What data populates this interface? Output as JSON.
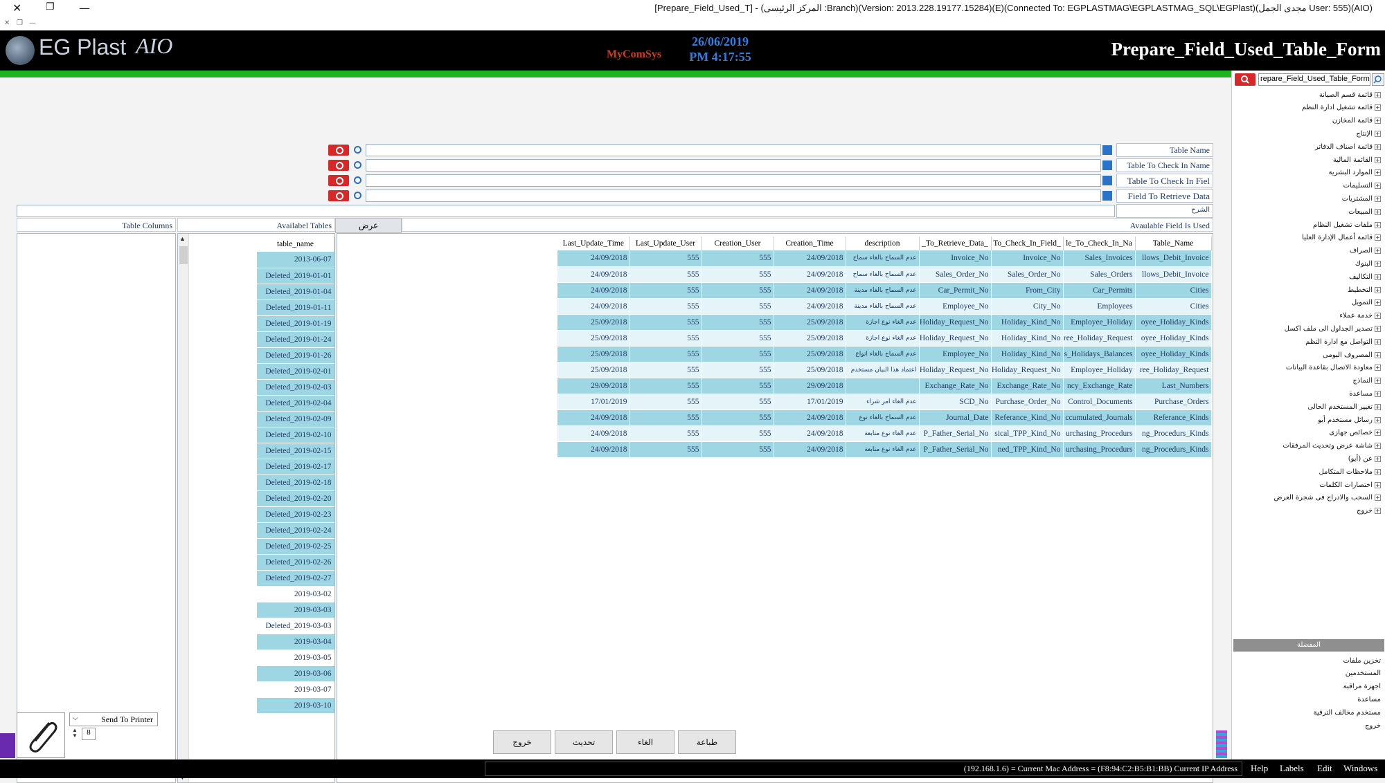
{
  "window": {
    "title": "[Prepare_Field_Used_T] - (المركز الرئيسى :Branch)(Version: 2013.228.19177.15284)(E)(Connected To: EGPLASTMAG\\EGPLASTMAG_SQL\\EGPlast)(مجدى الجمل User: 555)(AIO)"
  },
  "header": {
    "logo": "EG Plast",
    "logo_suffix": "AIO",
    "sponsor": "MyComSys",
    "date": "26/06/2019",
    "time": "PM 4:17:55",
    "form_title": "Prepare_Field_Used_Table_Form"
  },
  "tree": {
    "search_value": "repare_Field_Used_Table_Form",
    "items": [
      "قائمة قسم الصيانة",
      "قائمة تشغيل ادارة النظم",
      "قائمة المخازن",
      "الإنتاج",
      "قائمة اصناف الدفاتر",
      "القائمة المالية",
      "الموارد البشرية",
      "التسليمات",
      "المشتريات",
      "المبيعات",
      "ملفات تشغيل النظام",
      "قائمة أعمال الإدارة العليا",
      "الصراف",
      "البنوك",
      "التكاليف",
      "التخطيط",
      "التمويل",
      "خدمة عملاء",
      "تصدير الجداول الى ملف اكسل",
      "التواصل مع ادارة النظم",
      "المصروف اليومى",
      "معاودة الاتصال بقاعدة البيانات",
      "النماذج",
      "مساعدة",
      "تغيير المستخدم الحالى",
      "رسائل مستخدم أيو",
      "خصائص جهازى",
      "شاشة عرض وتحديث المرفقات",
      "عن (أيو)",
      "ملاحظات المتكامل",
      "اختصارات الكلمات",
      "السحب والادراج فى شجرة العرض",
      "خروج"
    ],
    "favorites_title": "المفضلة",
    "favorites": [
      "تخزين ملفات",
      "المستخدمين",
      "اجهزة مراقبة",
      "مساعدة",
      "مستخدم مخالف الترقية",
      "خروج"
    ]
  },
  "form": {
    "fields": {
      "table_name": "Table Name",
      "table_to_check_in_name": "Table To Check In Name",
      "table_to_check_in_field": "Table To Check In Fiel",
      "field_to_retrieve_data": "Field To Retrieve Data",
      "description": "الشرح"
    },
    "sections": {
      "table_columns": "Table Columns",
      "available_tables": "Availabel Tables",
      "show_button": "عرض",
      "available_field_is_used": "Avaulable Field Is Used"
    }
  },
  "tables_list": {
    "header": "table_name",
    "rows": [
      "2013-06-07",
      "Deleted_2019-01-01",
      "Deleted_2019-01-04",
      "Deleted_2019-01-11",
      "Deleted_2019-01-19",
      "Deleted_2019-01-24",
      "Deleted_2019-01-26",
      "Deleted_2019-02-01",
      "Deleted_2019-02-03",
      "Deleted_2019-02-04",
      "Deleted_2019-02-09",
      "Deleted_2019-02-10",
      "Deleted_2019-02-15",
      "Deleted_2019-02-17",
      "Deleted_2019-02-18",
      "Deleted_2019-02-20",
      "Deleted_2019-02-23",
      "Deleted_2019-02-24",
      "Deleted_2019-02-25",
      "Deleted_2019-02-26",
      "Deleted_2019-02-27",
      "2019-03-02",
      "2019-03-03",
      "Deleted_2019-03-03",
      "2019-03-04",
      "2019-03-05",
      "2019-03-06",
      "2019-03-07",
      "2019-03-10"
    ]
  },
  "fields_grid": {
    "headers": [
      "Last_Update_Time",
      "Last_Update_User",
      "Creation_User",
      "Creation_Time",
      "description",
      "_To_Retrieve_Data_",
      "To_Check_In_Field_",
      "le_To_Check_In_Na",
      "Table_Name"
    ],
    "rows": [
      [
        "24/09/2018",
        "555",
        "555",
        "24/09/2018",
        "عدم السماح بالغاء سماح",
        "Invoice_No",
        "Invoice_No",
        "Sales_Invoices",
        "llows_Debit_Invoice"
      ],
      [
        "24/09/2018",
        "555",
        "555",
        "24/09/2018",
        "عدم السماح بالغاء سماح",
        "Sales_Order_No",
        "Sales_Order_No",
        "Sales_Orders",
        "llows_Debit_Invoice"
      ],
      [
        "24/09/2018",
        "555",
        "555",
        "24/09/2018",
        "عدم السماح بالغاء مدينة",
        "Car_Permit_No",
        "From_City",
        "Car_Permits",
        "Cities"
      ],
      [
        "24/09/2018",
        "555",
        "555",
        "24/09/2018",
        "عدم السماح بالغاء مدينة",
        "Employee_No",
        "City_No",
        "Employees",
        "Cities"
      ],
      [
        "25/09/2018",
        "555",
        "555",
        "25/09/2018",
        "عدم الغاء نوع اجازة",
        "Holiday_Request_No",
        "Holiday_Kind_No",
        "Employee_Holiday",
        "oyee_Holiday_Kinds"
      ],
      [
        "25/09/2018",
        "555",
        "555",
        "25/09/2018",
        "عدم الغاء نوع اجازة",
        "Holiday_Request_No",
        "Holiday_Kind_No",
        "ree_Holiday_Request",
        "oyee_Holiday_Kinds"
      ],
      [
        "25/09/2018",
        "555",
        "555",
        "25/09/2018",
        "عدم السماح بالغاء انواع",
        "Employee_No",
        "Holiday_Kind_No",
        "s_Holidays_Balances",
        "oyee_Holiday_Kinds"
      ],
      [
        "25/09/2018",
        "555",
        "555",
        "25/09/2018",
        "اعتماد هذا البيان مستخدم",
        "Holiday_Request_No",
        "Holiday_Request_No",
        "Employee_Holiday",
        "ree_Holiday_Request"
      ],
      [
        "29/09/2018",
        "555",
        "555",
        "29/09/2018",
        "",
        "Exchange_Rate_No",
        "Exchange_Rate_No",
        "ncy_Exchange_Rate",
        "Last_Numbers"
      ],
      [
        "17/01/2019",
        "555",
        "555",
        "17/01/2019",
        "عدم الغاء امر شراء",
        "SCD_No",
        "Purchase_Order_No",
        "Control_Documents",
        "Purchase_Orders"
      ],
      [
        "24/09/2018",
        "555",
        "555",
        "24/09/2018",
        "عدم السماح بالغاء نوع",
        "Journal_Date",
        "Referance_Kind_No",
        "ccumulated_Journals",
        "Referance_Kinds"
      ],
      [
        "24/09/2018",
        "555",
        "555",
        "24/09/2018",
        "عدم الغاء نوع متابعة",
        "P_Father_Serial_No",
        "sical_TPP_Kind_No",
        "urchasing_Procedurs",
        "ng_Procedurs_Kinds"
      ],
      [
        "24/09/2018",
        "555",
        "555",
        "24/09/2018",
        "عدم الغاء نوع متابعة",
        "P_Father_Serial_No",
        "ned_TPP_Kind_No",
        "urchasing_Procedurs",
        "ng_Procedurs_Kinds"
      ]
    ]
  },
  "bottom": {
    "printer_label": "Send To Printer",
    "copies": "8",
    "buttons": {
      "exit": "خروج",
      "refresh": "تحديث",
      "cancel": "الغاء",
      "print": "طباعة"
    }
  },
  "status": {
    "address_text": "(192.168.1.6) = Current Mac Address = (F8:94:C2:B5:B1:BB) Current IP Address",
    "menu": [
      "Help",
      "Labels",
      "Edit",
      "Windows"
    ]
  }
}
